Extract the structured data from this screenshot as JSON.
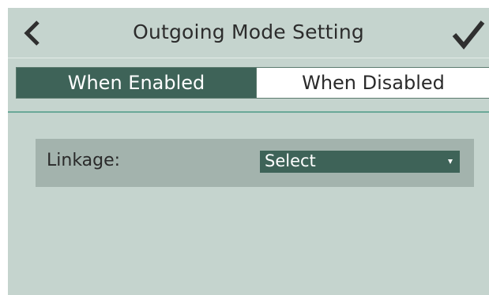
{
  "header": {
    "title": "Outgoing Mode Setting",
    "back_icon": "chevron-left-icon",
    "confirm_icon": "checkmark-icon"
  },
  "tabs": [
    {
      "label": "When Enabled",
      "active": true
    },
    {
      "label": "When Disabled",
      "active": false
    }
  ],
  "linkage": {
    "label": "Linkage:",
    "selected": "Select",
    "dropdown_icon": "caret-down-icon"
  },
  "colors": {
    "background": "#c5d4ce",
    "accent": "#3e6358",
    "row_background": "#a3b3ad",
    "divider": "#6aa898"
  }
}
